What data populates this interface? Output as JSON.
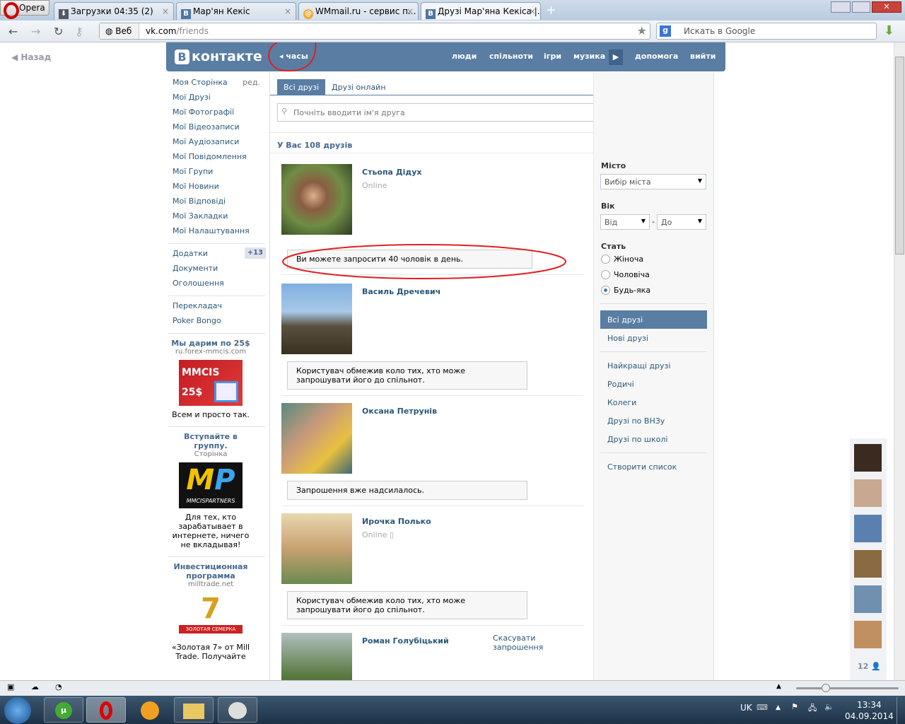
{
  "browser": {
    "menu": "Opera",
    "tabs": [
      "Загрузки 04:35 (2)",
      "Мар'ян Кекіс",
      "WMmail.ru - сервис п...",
      "Друзі Мар'яна Кекіса |..."
    ],
    "web_label": "Веб",
    "url_host": "vk.com",
    "url_path": "/friends",
    "search_placeholder": "Искать в Google",
    "back": "Назад"
  },
  "header": {
    "logo": "контакте",
    "logo_letter": "В",
    "clock": "часы",
    "nav": [
      "люди",
      "спільноти",
      "ігри",
      "музика",
      "допомога",
      "вийти"
    ]
  },
  "left_menu": {
    "items": [
      "Моя Сторінка",
      "Мої Друзі",
      "Мої Фотографії",
      "Мої Відеозаписи",
      "Мої Аудіозаписи",
      "Мої Повідомлення",
      "Мої Групи",
      "Мої Новини",
      "Мої Відповіді",
      "Мої Закладки",
      "Мої Налаштування"
    ],
    "edit": "ред.",
    "items2": [
      "Додатки",
      "Документи",
      "Оголошення"
    ],
    "apps_badge": "+13",
    "items3": [
      "Перекладач",
      "Poker Bongo"
    ]
  },
  "ads": [
    {
      "title": "Мы дарим по 25$",
      "sub": "ru.forex-mmcis.com",
      "img": "MMCIS 25$",
      "text": "Всем и просто так."
    },
    {
      "title": "Вступайте в группу.",
      "sub": "Сторінка",
      "img": "MP MMCISPARTNERS",
      "text": "Для тех, кто зарабатывает в интернете, ничего не вкладывая!"
    },
    {
      "title": "Инвестиционная программа",
      "sub": "milltrade.net",
      "img": "7 ЗОЛОТАЯ СЕМЕРКА",
      "text": "«Золотая 7» от Mill Trade. Получайте"
    }
  ],
  "content": {
    "tabs": [
      "Всі друзі",
      "Друзі онлайн"
    ],
    "search_placeholder": "Почніть вводити ім'я друга",
    "count": "У Вас 108 друзів",
    "friends": [
      {
        "name": "Стьопа Дідух",
        "status": "Online",
        "msg": "Ви можете запросити 40 чоловік в день."
      },
      {
        "name": "Василь Дречевич",
        "status": "",
        "msg": "Користувач обмежив коло тих, хто може запрошувати його до спільнот."
      },
      {
        "name": "Оксана Петрунів",
        "status": "",
        "msg": "Запрошення вже надсилалось."
      },
      {
        "name": "Ирочка Полько",
        "status": "Online ▯",
        "msg": "Користувач обмежив коло тих, хто може запрошувати його до спільнот."
      },
      {
        "name": "Роман Голубіцький",
        "status": "",
        "msg": "",
        "action": "Скасувати запрошення"
      }
    ]
  },
  "filter": {
    "city_label": "Місто",
    "city": "Вибір міста",
    "age_label": "Вік",
    "from": "Від",
    "to": "До",
    "sex_label": "Стать",
    "sex": [
      "Жіноча",
      "Чоловіча",
      "Будь-яка"
    ],
    "sex_selected": 2,
    "lists": [
      "Всі друзі",
      "Нові друзі"
    ],
    "lists2": [
      "Найкращі друзі",
      "Родичі",
      "Колеги",
      "Друзі по ВНЗу",
      "Друзі по школі"
    ],
    "create": "Створити список"
  },
  "side": {
    "count": "12"
  },
  "tray": {
    "lang": "UK",
    "time": "13:34",
    "date": "04.09.2014"
  }
}
